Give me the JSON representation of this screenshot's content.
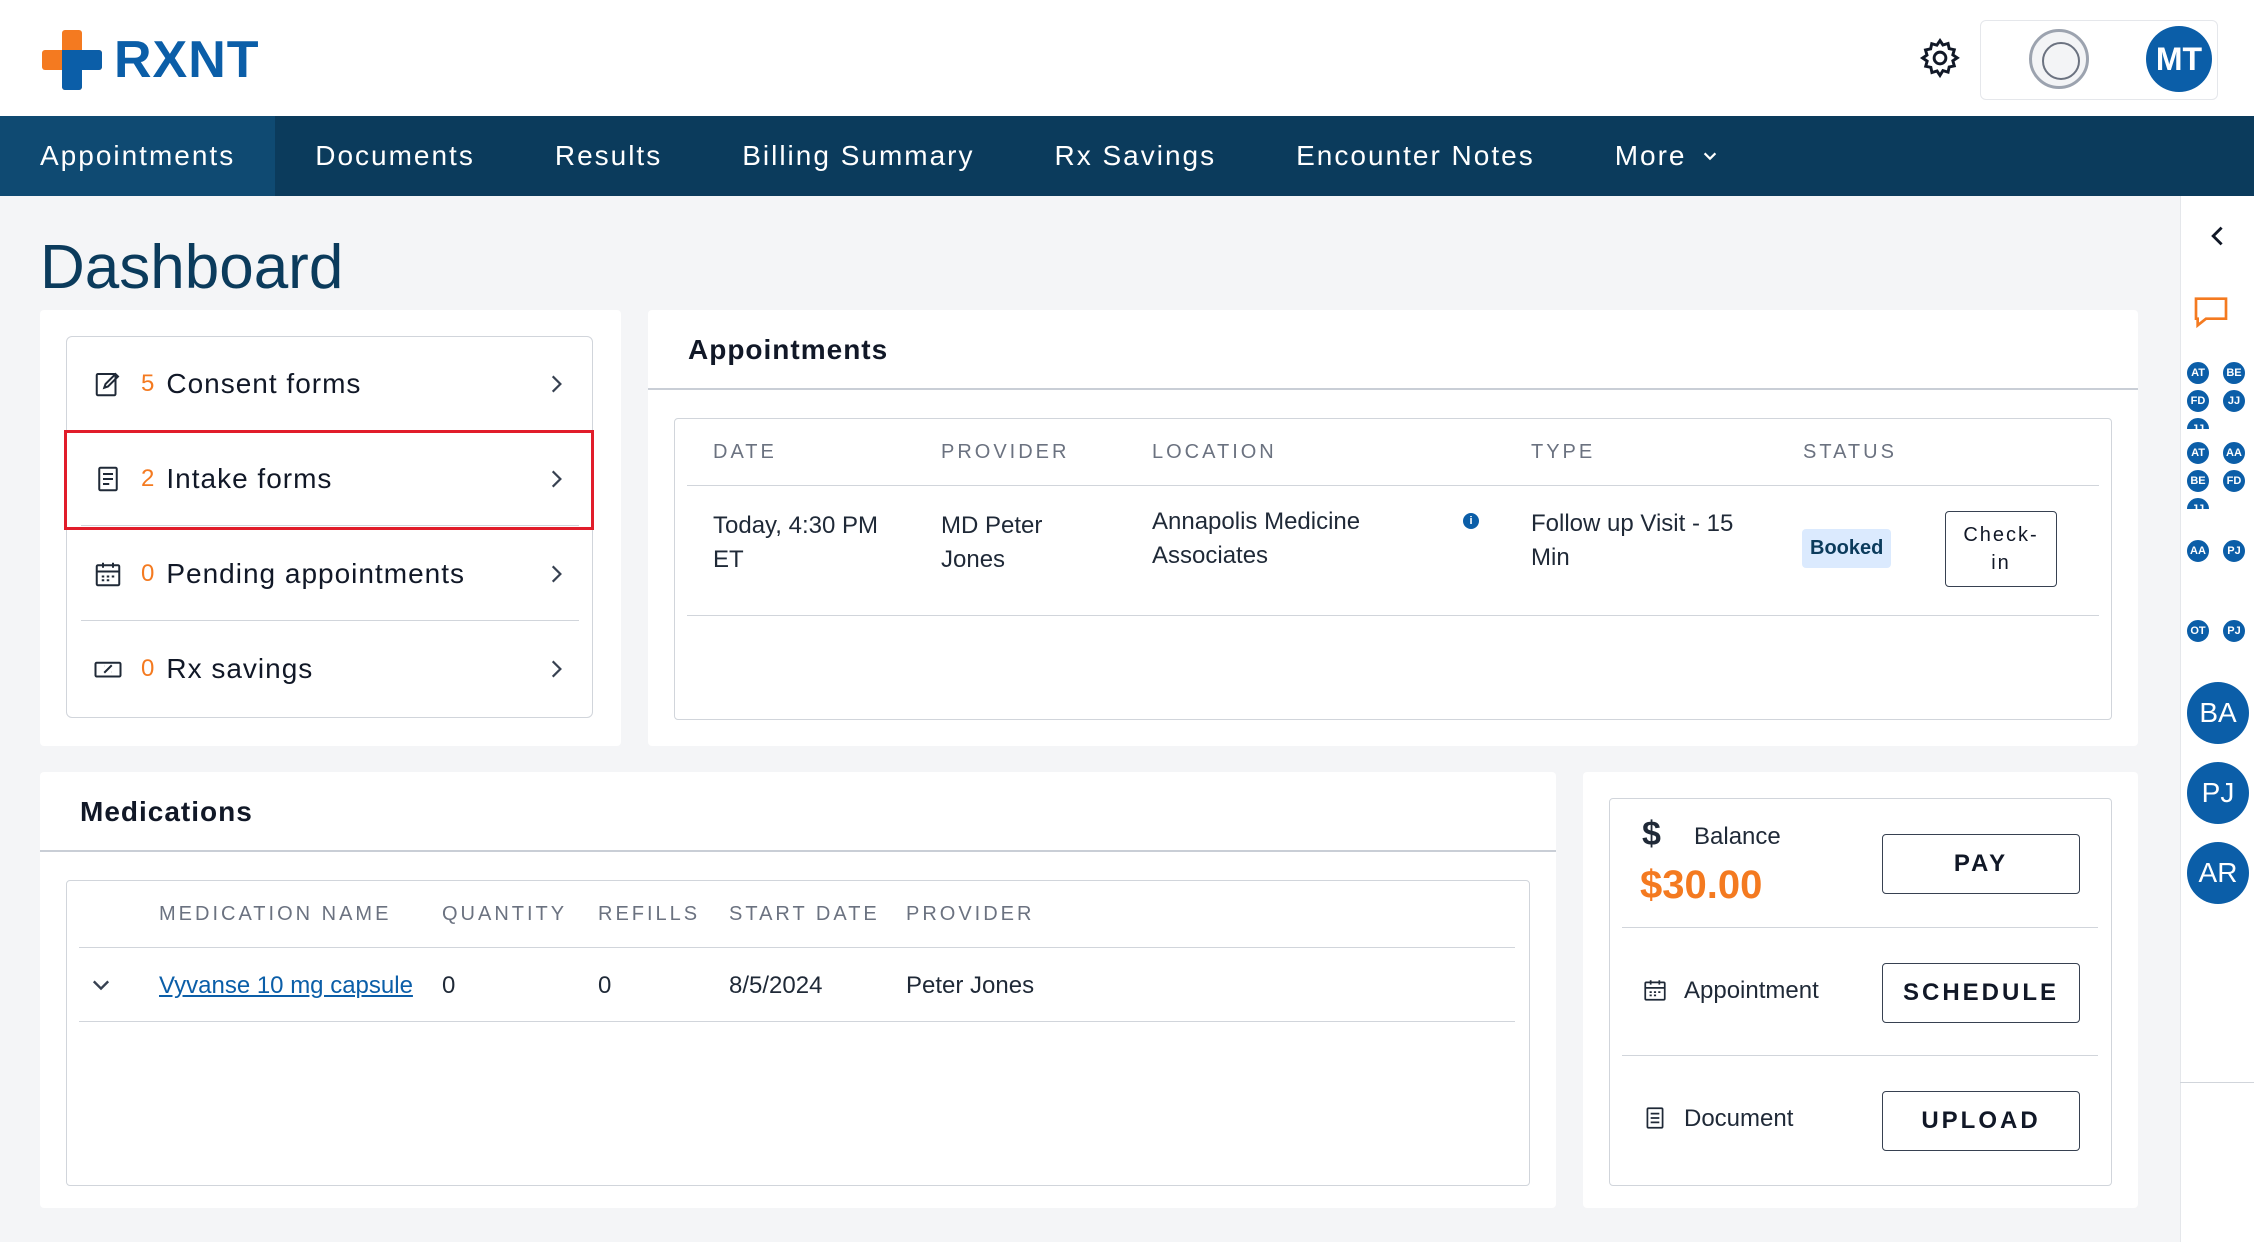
{
  "brand": {
    "name": "RXNT",
    "primary_color": "#0b5ea8",
    "accent_color": "#f47a20",
    "nav_color": "#0b3b5c"
  },
  "header": {
    "user_initials": "MT",
    "settings_icon": "gear-icon"
  },
  "nav": {
    "items": [
      "Appointments",
      "Documents",
      "Results",
      "Billing Summary",
      "Rx Savings",
      "Encounter Notes",
      "More"
    ],
    "active": "Appointments"
  },
  "page_title": "Dashboard",
  "quick_links": [
    {
      "count": "5",
      "label": "Consent forms",
      "icon": "edit-document-icon"
    },
    {
      "count": "2",
      "label": "Intake forms",
      "icon": "form-document-icon"
    },
    {
      "count": "0",
      "label": "Pending appointments",
      "icon": "calendar-icon"
    },
    {
      "count": "0",
      "label": "Rx savings",
      "icon": "discount-ticket-icon"
    }
  ],
  "appointments": {
    "title": "Appointments",
    "columns": [
      "DATE",
      "PROVIDER",
      "LOCATION",
      "TYPE",
      "STATUS"
    ],
    "rows": [
      {
        "date_line1": "Today, 4:30 PM",
        "date_line2": "ET",
        "provider_line1": "MD Peter",
        "provider_line2": "Jones",
        "location_line1": "Annapolis Medicine",
        "location_line2": "Associates",
        "type_line1": "Follow up Visit - 15",
        "type_line2": "Min",
        "status": "Booked",
        "action_line1": "Check-",
        "action_line2": "in"
      }
    ]
  },
  "medications": {
    "title": "Medications",
    "columns": [
      "MEDICATION NAME",
      "QUANTITY",
      "REFILLS",
      "START DATE",
      "PROVIDER"
    ],
    "rows": [
      {
        "name": "Vyvanse 10 mg capsule",
        "quantity": "0",
        "refills": "0",
        "start_date": "8/5/2024",
        "provider": "Peter Jones"
      }
    ]
  },
  "summary": {
    "balance_label": "Balance",
    "balance_amount": "$30.00",
    "pay_label": "PAY",
    "appointment_label": "Appointment",
    "schedule_label": "SCHEDULE",
    "document_label": "Document",
    "upload_label": "UPLOAD"
  },
  "rail": {
    "groups": [
      [
        "AT",
        "BE",
        "FD",
        "JJ",
        "JJ"
      ],
      [
        "AT",
        "AA",
        "BE",
        "FD",
        "JJ"
      ],
      [
        "AA",
        "PJ"
      ],
      [
        "OT",
        "PJ"
      ]
    ],
    "avatars": [
      "BA",
      "PJ",
      "AR"
    ]
  }
}
